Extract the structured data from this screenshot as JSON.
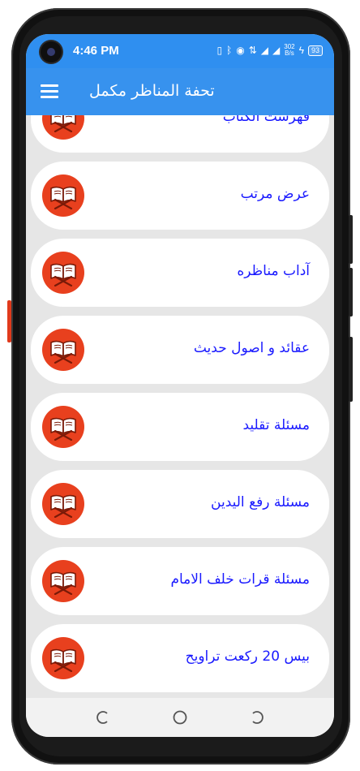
{
  "status_bar": {
    "time": "4:46 PM",
    "icons": [
      "vibrate-icon",
      "bluetooth-icon",
      "hotspot-icon",
      "data-arrows-icon",
      "4g-signal-icon",
      "signal-bars-icon"
    ],
    "net_speed_value": "302",
    "net_speed_unit": "B/s",
    "battery": "93"
  },
  "app_bar": {
    "title": "تحفة المناظر مكمل",
    "menu_icon": "hamburger-menu-icon"
  },
  "list": {
    "item_icon": "quran-book-icon",
    "items": [
      {
        "label": "فهرست الکتاب"
      },
      {
        "label": "عرض مرتب"
      },
      {
        "label": "آداب مناظره"
      },
      {
        "label": "عقائد و اصول حديث"
      },
      {
        "label": "مسئلة تقليد"
      },
      {
        "label": "مسئلة رفع اليدين"
      },
      {
        "label": "مسئلة قرات خلف الامام"
      },
      {
        "label": "بيس 20 رکعت تراويح"
      }
    ]
  },
  "nav_bar": {
    "buttons": [
      "recents-icon",
      "home-icon",
      "back-icon"
    ]
  },
  "colors": {
    "status_bar": "#2f8ff0",
    "app_bar": "#3792ee",
    "list_bg": "#e6e6e6",
    "badge": "#e8401e",
    "label": "#1a1aff"
  }
}
